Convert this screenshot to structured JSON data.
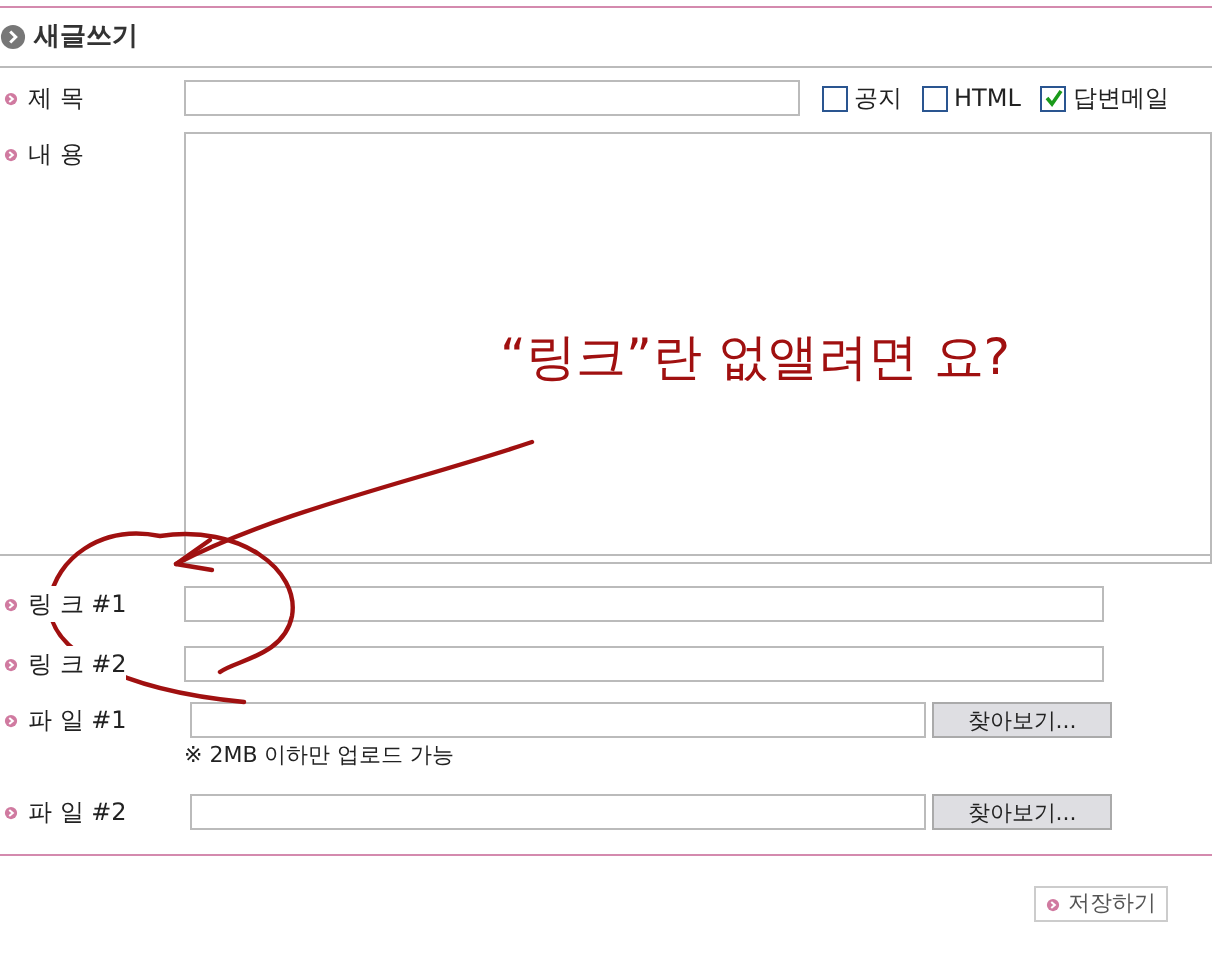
{
  "header": {
    "title": "새글쓰기"
  },
  "subject": {
    "label": "제 목",
    "options": [
      {
        "label": "공지",
        "checked": false
      },
      {
        "label": "HTML",
        "checked": false
      },
      {
        "label": "답변메일",
        "checked": true
      }
    ]
  },
  "content": {
    "label": "내 용"
  },
  "links": [
    {
      "label": "링 크 #1"
    },
    {
      "label": "링 크 #2"
    }
  ],
  "files": [
    {
      "label": "파 일 #1",
      "button": "찾아보기...",
      "note": "※ 2MB 이하만 업로드 가능"
    },
    {
      "label": "파 일 #2",
      "button": "찾아보기..."
    }
  ],
  "save_button": "저장하기",
  "annotation": {
    "text": "“링크”란 없앨려면 요?"
  }
}
